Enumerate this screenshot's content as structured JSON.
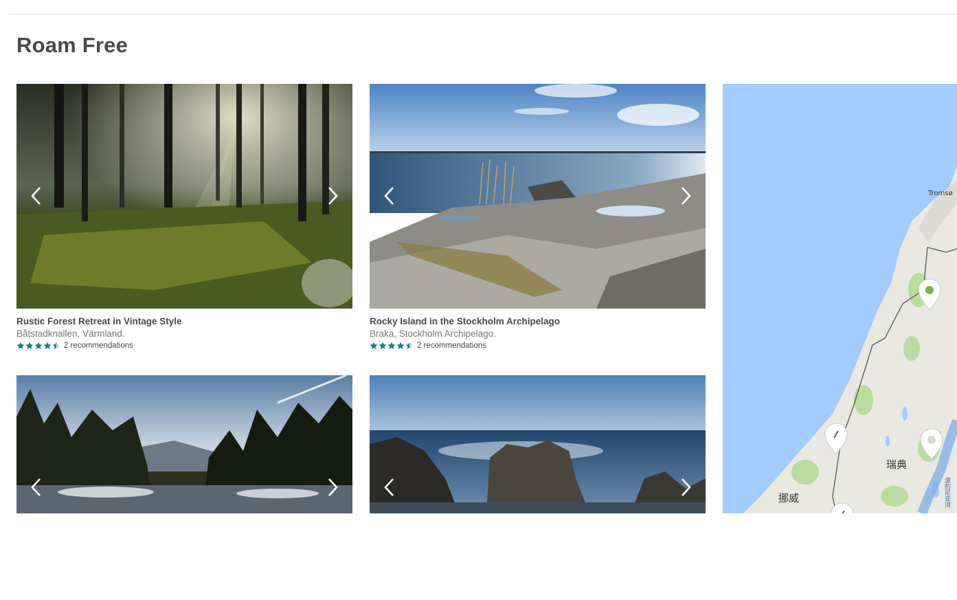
{
  "page": {
    "title": "Roam Free"
  },
  "listings": [
    {
      "title": "Rustic Forest Retreat in Vintage Style",
      "location": "Båtstadknallen, Värmland.",
      "rating": 4.5,
      "recommendations": "2 recommendations",
      "scene": "forest-photo"
    },
    {
      "title": "Rocky Island in the Stockholm Archipelago",
      "location": "Braka, Stockholm Archipelago.",
      "rating": 4.5,
      "recommendations": "2 recommendations",
      "scene": "archipelago-photo"
    },
    {
      "scene": "lake-forest-photo"
    },
    {
      "scene": "sea-rocks-photo"
    }
  ],
  "map": {
    "labels": {
      "city": "Tromsø",
      "sweden": "瑞典",
      "norway": "挪威",
      "gulf": "波的尼亚湾"
    },
    "colors": {
      "water": "#a3ccff",
      "land": "#e8e8e0",
      "forest": "#b8dca0",
      "border": "#555555",
      "marker": "#ffffff",
      "marker_dot": "#7cb342"
    }
  },
  "colors": {
    "star": "#008489",
    "text": "#484848",
    "subtext": "#767676"
  },
  "icons": {
    "prev": "chevron-left-icon",
    "next": "chevron-right-icon",
    "star": "star-icon",
    "marker": "map-pin-icon"
  }
}
